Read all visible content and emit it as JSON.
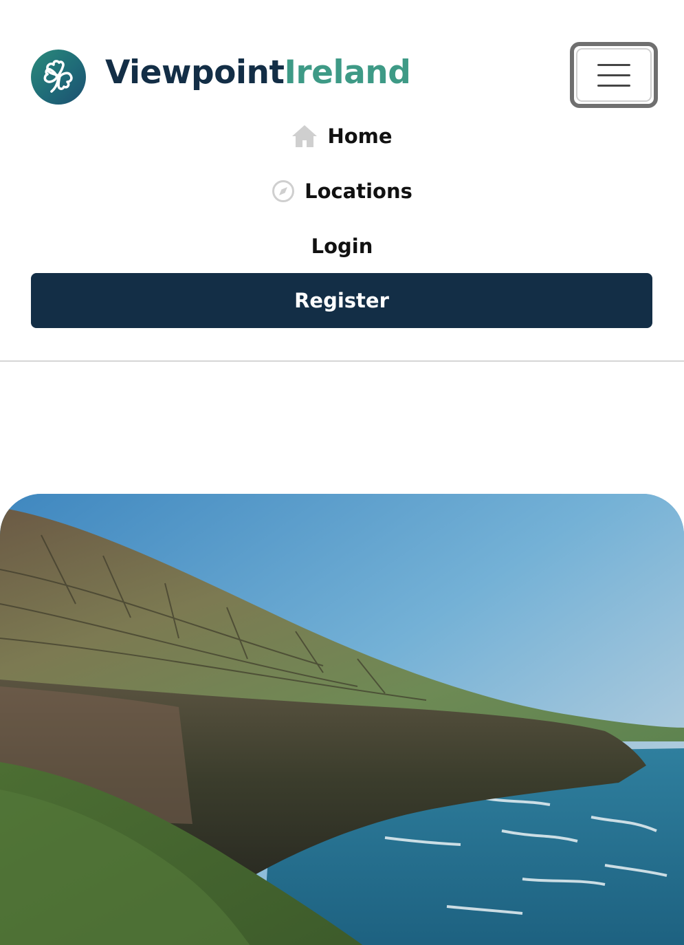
{
  "brand": {
    "name_primary": "Viewpoint",
    "name_accent": "Ireland",
    "logo_icon": "shamrock-icon",
    "colors": {
      "primary": "#132e46",
      "accent": "#3e9a86"
    }
  },
  "header": {
    "menu_toggle_icon": "hamburger-menu-icon"
  },
  "nav": {
    "items": [
      {
        "label": "Home",
        "icon": "home-icon"
      },
      {
        "label": "Locations",
        "icon": "compass-icon"
      },
      {
        "label": "Login"
      }
    ],
    "register_label": "Register"
  },
  "hero": {
    "image": "coastal-cliffs-photo"
  }
}
